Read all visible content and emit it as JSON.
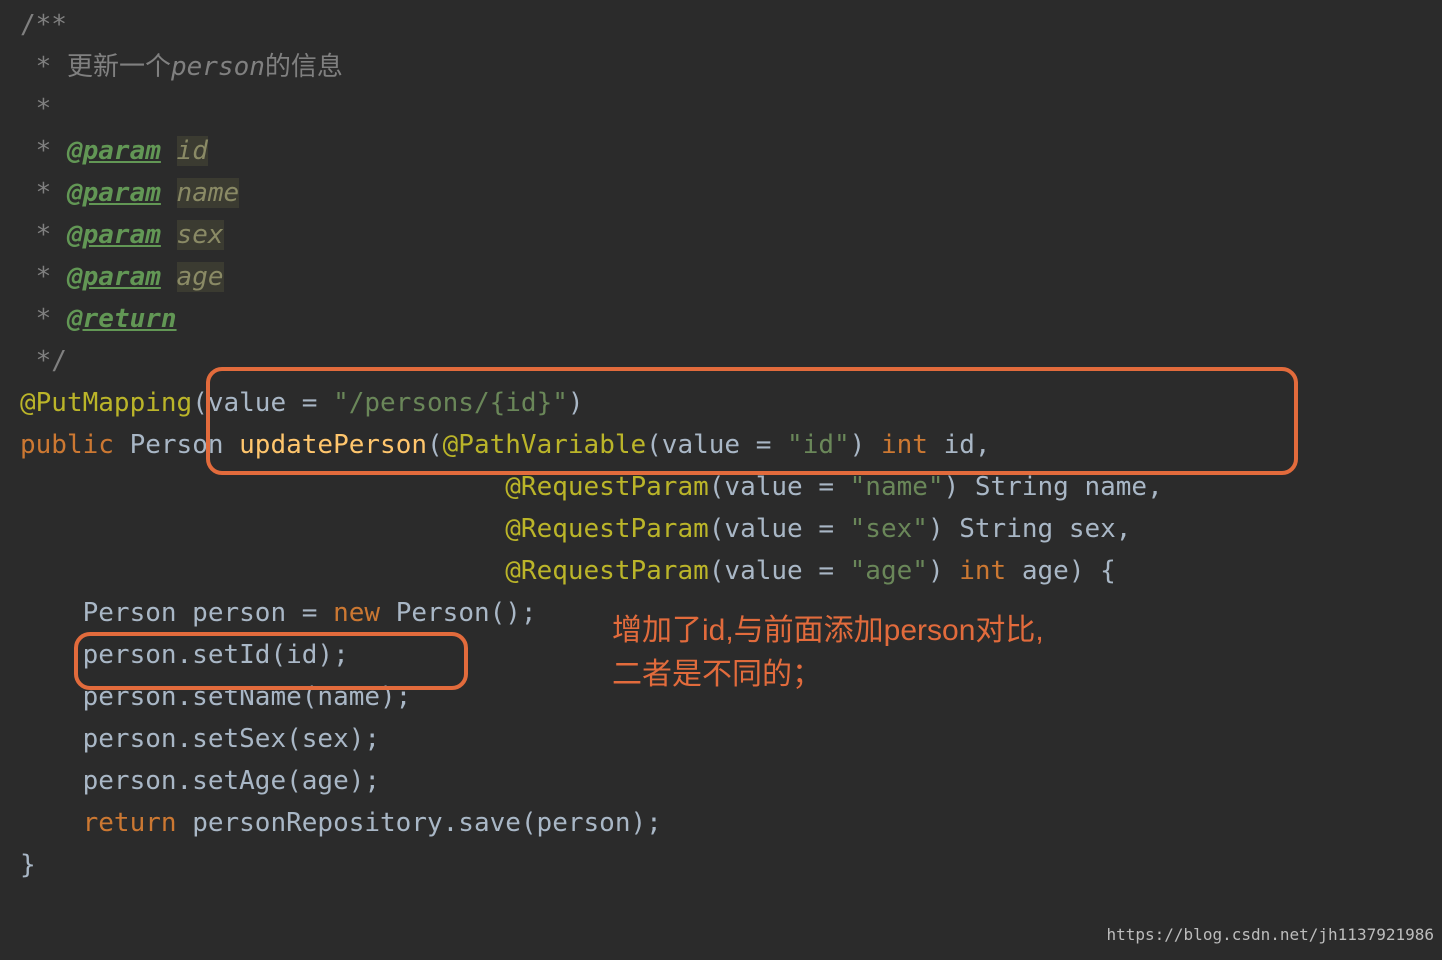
{
  "code": {
    "l1": "/**",
    "l2_prefix": " * ",
    "l2_cn_a": "更新一个",
    "l2_person": "person",
    "l2_cn_b": "的信息",
    "l3": " *",
    "l4_prefix": " * ",
    "l4_tag": "@param",
    "l4_arg": "id",
    "l5_prefix": " * ",
    "l5_tag": "@param",
    "l5_arg": "name",
    "l6_prefix": " * ",
    "l6_tag": "@param",
    "l6_arg": "sex",
    "l7_prefix": " * ",
    "l7_tag": "@param",
    "l7_arg": "age",
    "l8_prefix": " * ",
    "l8_tag": "@return",
    "l9": " */",
    "l10_anno": "@PutMapping",
    "l10_open": "(value = ",
    "l10_str": "\"/persons/{id}\"",
    "l10_close": ")",
    "l11_kw": "public ",
    "l11_type": "Person ",
    "l11_method": "updatePerson",
    "l11_open": "(",
    "l11_anno": "@PathVariable",
    "l11_p": "(value = ",
    "l11_str": "\"id\"",
    "l11_mid": ") ",
    "l11_kw2": "int ",
    "l11_end": "id,",
    "indent2": "                               ",
    "l12_anno": "@RequestParam",
    "l12_p": "(value = ",
    "l12_str": "\"name\"",
    "l12_mid": ") String name,",
    "l13_anno": "@RequestParam",
    "l13_p": "(value = ",
    "l13_str": "\"sex\"",
    "l13_mid": ") String sex,",
    "l14_anno": "@RequestParam",
    "l14_p": "(value = ",
    "l14_str": "\"age\"",
    "l14_mid": ") ",
    "l14_kw": "int ",
    "l14_end": "age) {",
    "l15_a": "    Person person = ",
    "l15_kw": "new ",
    "l15_b": "Person();",
    "l16": "    person.setId(id);",
    "l17": "    person.setName(name);",
    "l18": "    person.setSex(sex);",
    "l19": "    person.setAge(age);",
    "l20_kw": "    return ",
    "l20_a": "personRepository.save(person);",
    "l21": "}"
  },
  "annotation": {
    "line1": "增加了id,与前面添加person对比,",
    "line2": "二者是不同的；"
  },
  "watermark": "https://blog.csdn.net/jh1137921986"
}
